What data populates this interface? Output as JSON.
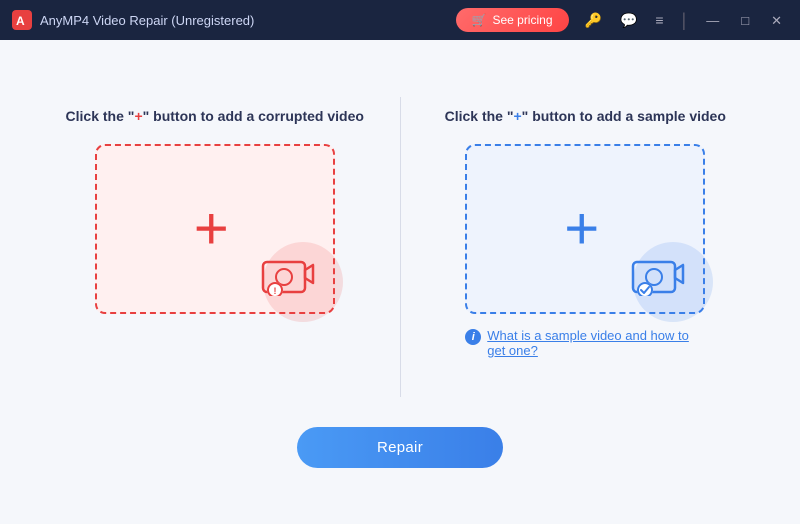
{
  "titlebar": {
    "logo_alt": "AnyMP4 logo",
    "title": "AnyMP4 Video Repair (Unregistered)",
    "pricing_label": "See pricing",
    "pricing_icon": "🛒",
    "controls": {
      "key_icon": "🔑",
      "chat_icon": "💬",
      "menu_icon": "≡",
      "minimize": "—",
      "maximize": "□",
      "close": "✕"
    }
  },
  "left_panel": {
    "instruction_prefix": "Click the \"",
    "instruction_plus": "+",
    "instruction_suffix": "\" button to add a corrupted video",
    "plus_symbol": "+",
    "camera_alt": "corrupted video camera icon"
  },
  "right_panel": {
    "instruction_prefix": "Click the \"",
    "instruction_plus": "+",
    "instruction_suffix": "\" button to add a sample video",
    "plus_symbol": "+",
    "camera_alt": "sample video camera icon",
    "info_link_text": "What is a sample video and how to get one?"
  },
  "repair_button": {
    "label": "Repair"
  }
}
